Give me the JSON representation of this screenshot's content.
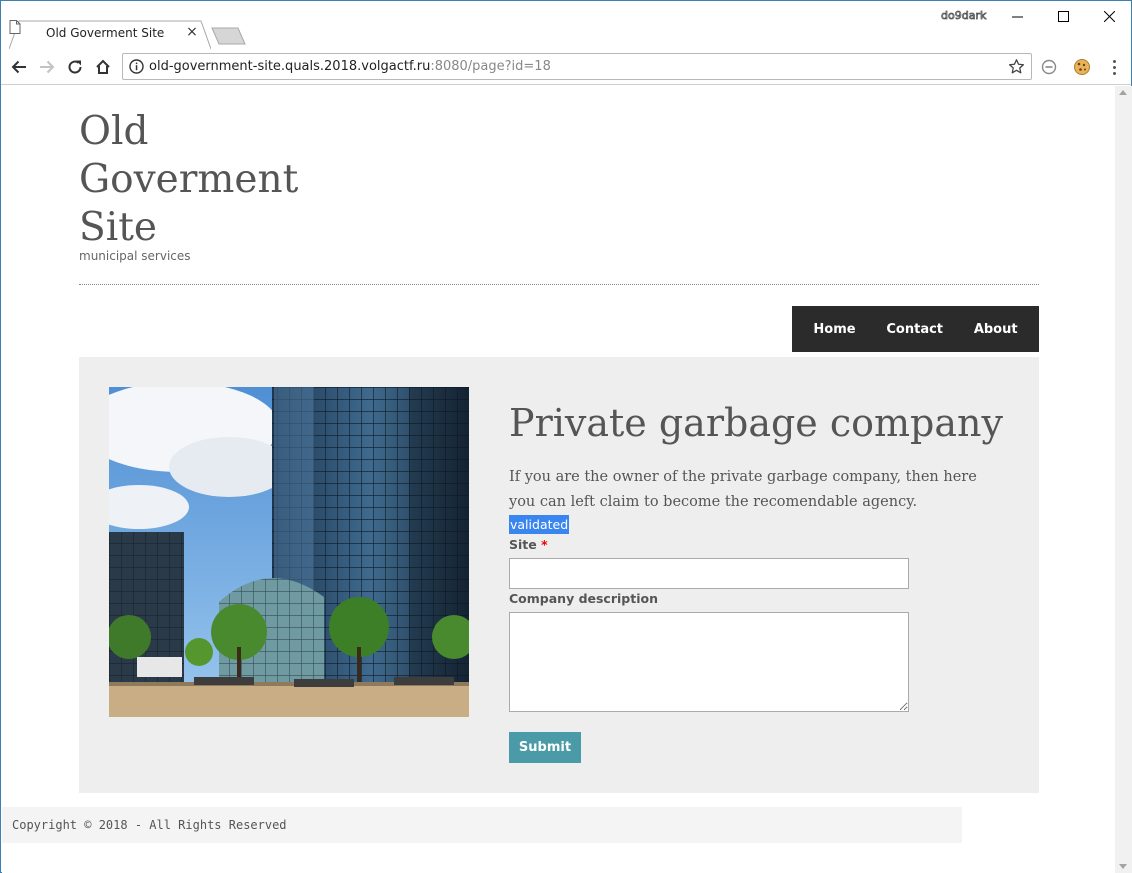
{
  "browser": {
    "tab_title": "Old Goverment Site",
    "tab_close": "×",
    "profile_name": "do9dark",
    "url_main": "old-government-site.quals.2018.volgactf.ru",
    "url_rest": ":8080/page?id=18"
  },
  "site": {
    "title": "Old Goverment Site",
    "tagline": "municipal services"
  },
  "nav": {
    "items": [
      {
        "label": "Home"
      },
      {
        "label": "Contact"
      },
      {
        "label": "About"
      }
    ]
  },
  "main": {
    "heading": "Private garbage company",
    "intro": "If you are the owner of the private garbage company, then here you can left claim to become the recomendable agency.",
    "validated_text": "validated",
    "site_label": "Site",
    "required_mark": "*",
    "site_value": "",
    "description_label": "Company description",
    "description_value": "",
    "submit_label": "Submit"
  },
  "footer": {
    "copyright": "Copyright © 2018 - All Rights Reserved"
  },
  "colors": {
    "nav_bg": "#2b2b2b",
    "content_bg": "#eeeeee",
    "submit_bg": "#4b9aa7",
    "selection_bg": "#3a86f0"
  },
  "icons": [
    "page-favicon-icon",
    "back-icon",
    "forward-icon",
    "reload-icon",
    "home-icon",
    "info-icon",
    "star-icon",
    "block-icon",
    "cookie-icon",
    "menu-icon",
    "minimize-icon",
    "maximize-icon",
    "close-icon"
  ]
}
